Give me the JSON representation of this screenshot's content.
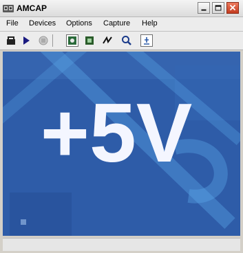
{
  "window": {
    "title": "AMCAP"
  },
  "menu": [
    {
      "label": "File"
    },
    {
      "label": "Devices"
    },
    {
      "label": "Options"
    },
    {
      "label": "Capture"
    },
    {
      "label": "Help"
    }
  ],
  "toolbar": {
    "items": [
      {
        "icon": "open-icon"
      },
      {
        "icon": "play-icon"
      },
      {
        "icon": "stop-icon"
      },
      {
        "icon": "preview-icon"
      },
      {
        "icon": "capture-icon"
      },
      {
        "icon": "trigger-icon"
      },
      {
        "icon": "zoom-icon"
      },
      {
        "icon": "overlay-icon"
      }
    ]
  },
  "video": {
    "overlay_text": "+5V",
    "background_color": "#2c5aa8",
    "text_color": "#f4f6ff"
  },
  "status": {
    "text": ""
  }
}
